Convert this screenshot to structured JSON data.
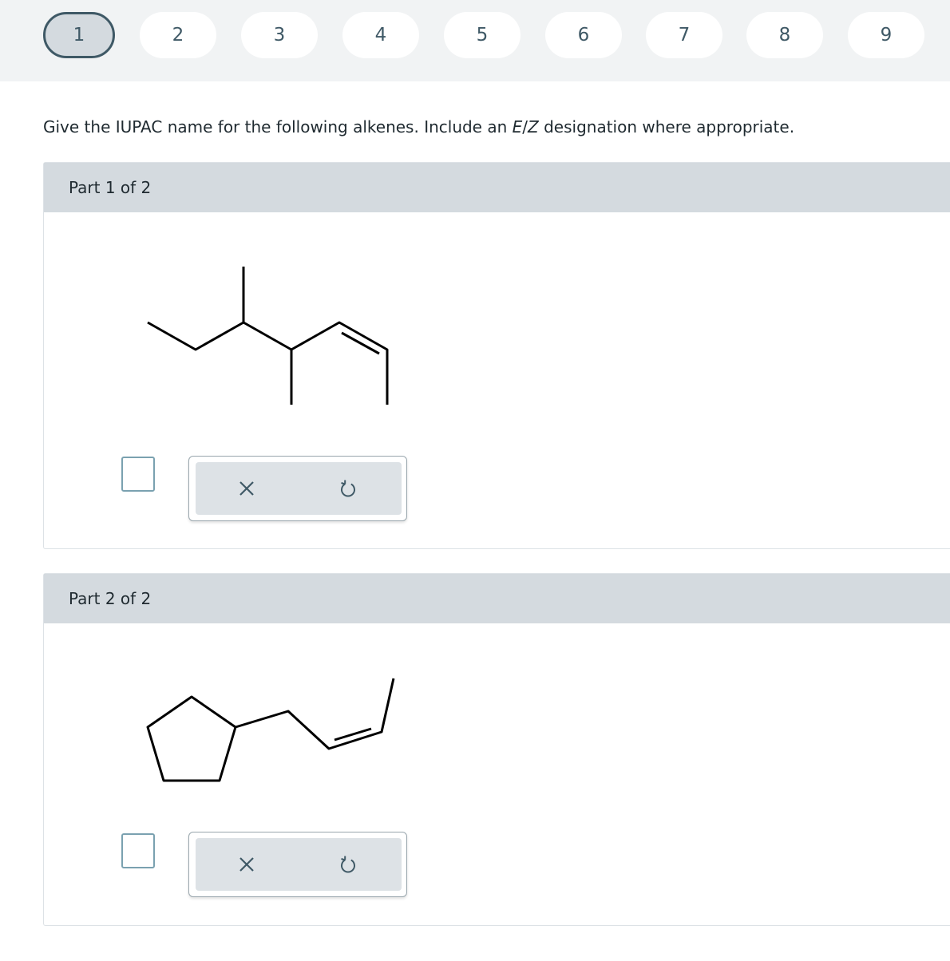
{
  "question_nav": {
    "items": [
      "1",
      "2",
      "3",
      "4",
      "5",
      "6",
      "7",
      "8",
      "9"
    ],
    "active": "1"
  },
  "question": {
    "text_before": "Give the IUPAC name for the following alkenes. Include an ",
    "emphasis_1": "E",
    "separator": "/",
    "emphasis_2": "Z",
    "text_after": " designation where appropriate."
  },
  "parts": [
    {
      "label": "Part 1 of 2"
    },
    {
      "label": "Part 2 of 2"
    }
  ],
  "icons": {
    "clear": "close-icon",
    "undo": "undo-icon"
  },
  "colors": {
    "nav_background": "#f1f3f4",
    "active_border": "#3f5966",
    "part_header": "#d4dadf",
    "toolbar": "#dde2e6",
    "checkbox_border": "#7aa1b0"
  }
}
